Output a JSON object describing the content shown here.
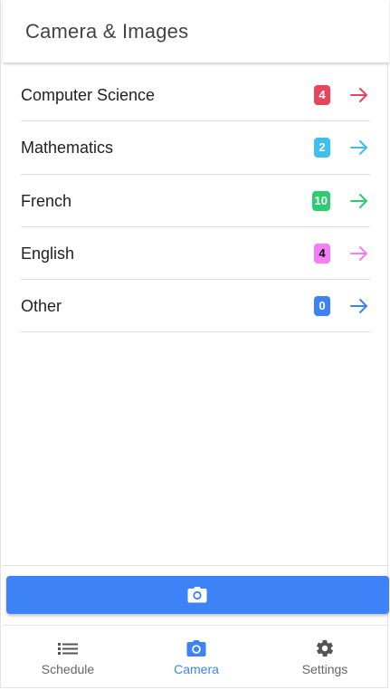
{
  "header": {
    "title": "Camera & Images"
  },
  "subjects": [
    {
      "label": "Computer Science",
      "count": "4",
      "color": "#e8455b",
      "text_color": "#ffffff"
    },
    {
      "label": "Mathematics",
      "count": "2",
      "color": "#3fbff0",
      "text_color": "#ffffff"
    },
    {
      "label": "French",
      "count": "10",
      "color": "#2ecc71",
      "text_color": "#ffffff"
    },
    {
      "label": "English",
      "count": "4",
      "color": "#f57df5",
      "text_color": "#000000"
    },
    {
      "label": "Other",
      "count": "0",
      "color": "#3d82f6",
      "text_color": "#ffffff"
    }
  ],
  "camera_button": {
    "icon": "camera-icon",
    "color": "#3d82f6"
  },
  "tabs": [
    {
      "label": "Schedule",
      "icon": "list-icon",
      "active": false
    },
    {
      "label": "Camera",
      "icon": "camera-icon",
      "active": true
    },
    {
      "label": "Settings",
      "icon": "gear-icon",
      "active": false
    }
  ],
  "colors": {
    "accent": "#3d82f6",
    "inactive": "#555555"
  }
}
